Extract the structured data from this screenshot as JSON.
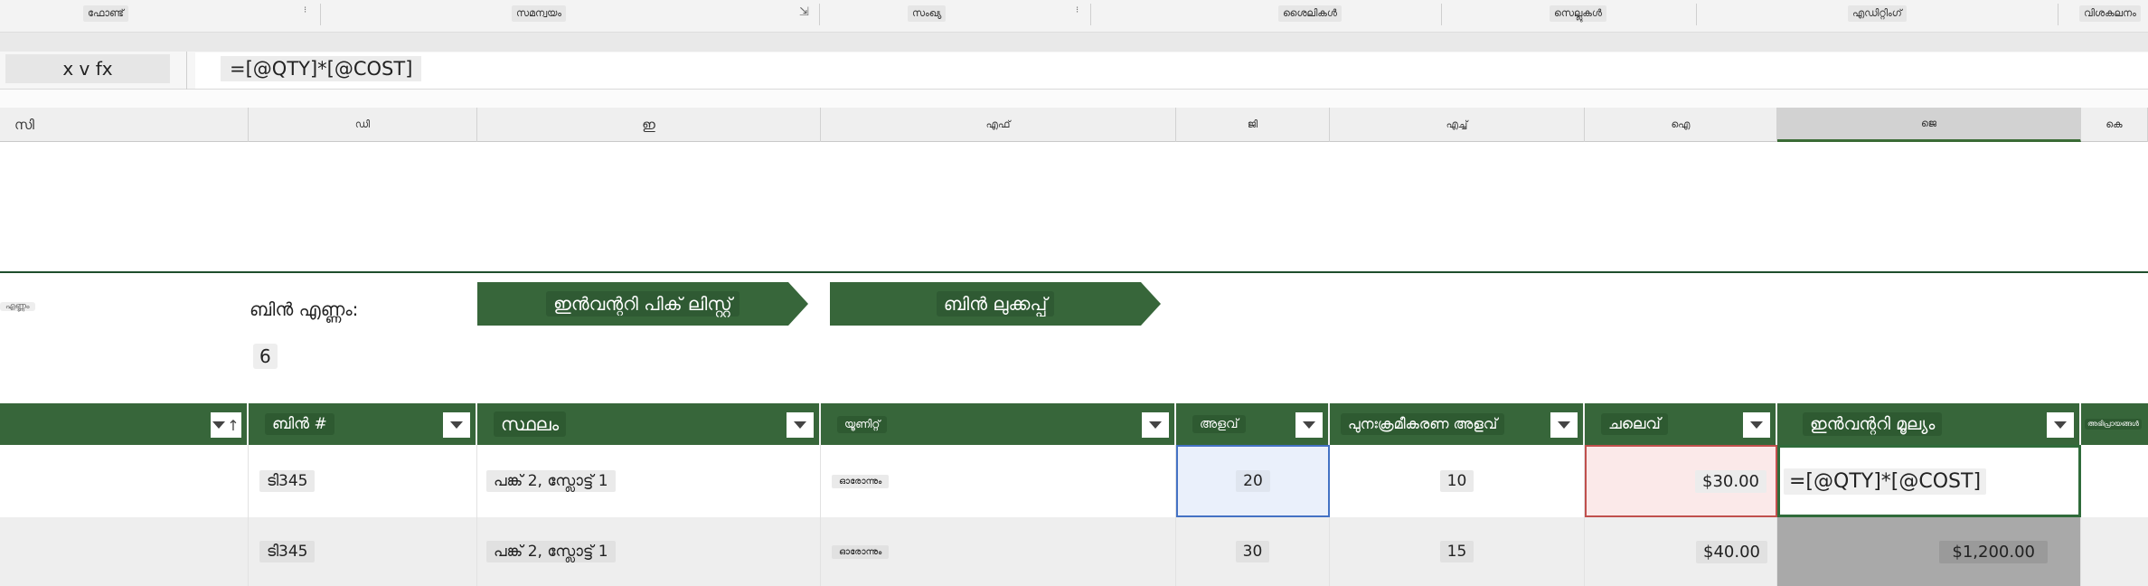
{
  "ribbon": {
    "groups": [
      "ഫോണ്ട്",
      "സമന്വയം",
      "സംഖ്യ",
      "ശൈലികൾ",
      "സെല്ലുകൾ",
      "എഡിറ്റിംഗ്",
      "വിശകലനം"
    ]
  },
  "formula_bar": {
    "name_box": "x v fx",
    "formula": "=[@QTY]*[@COST]"
  },
  "columns": [
    "സി",
    "ഡി",
    "ഇ",
    "എഫ്",
    "ജി",
    "എച്ച്",
    "ഐ",
    "ജെ",
    "കെ"
  ],
  "header_section": {
    "left_label": "എണ്ണം",
    "bin_count_label": "ബിൻ എണ്ണം:",
    "bin_count_value": "6",
    "nav_buttons": [
      "ഇൻവന്ററി പിക് ലിസ്റ്റ്",
      "ബിൻ ലുക്കപ്പ്"
    ]
  },
  "table": {
    "headers": [
      "ബിൻ #",
      "സ്ഥലം",
      "യൂണിറ്റ്",
      "അളവ്",
      "പുനഃക്രമീകരണ അളവ്",
      "ചലെവ്",
      "ഇൻവന്ററി മൂല്യം",
      "അഭിപ്രായങ്ങൾ"
    ],
    "rows": [
      {
        "bin": "ടി345",
        "location": "പങ്ക് 2, സ്ലോട്ട് 1",
        "unit": "ഓരോന്നും",
        "qty": "20",
        "reorder": "10",
        "cost": "$30.00",
        "value": "=[@QTY]*[@COST]"
      },
      {
        "bin": "ടി345",
        "location": "പങ്ക് 2, സ്ലോട്ട് 1",
        "unit": "ഓരോന്നും",
        "qty": "30",
        "reorder": "15",
        "cost": "$40.00",
        "value": "$1,200.00"
      }
    ]
  },
  "colors": {
    "accent": "#37663a",
    "selection": "#2f6b3a",
    "qty_highlight": "#eaf0fb",
    "cost_highlight": "#fbe9e9"
  }
}
